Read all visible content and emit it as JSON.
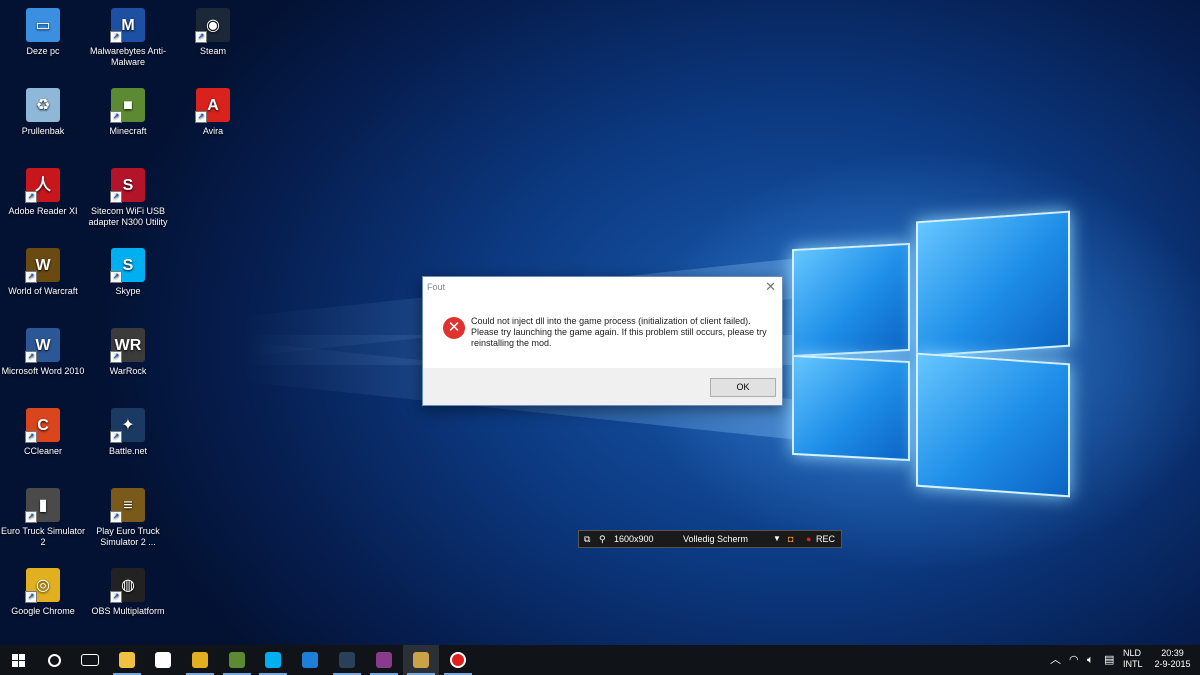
{
  "desktop": {
    "icons": [
      {
        "label": "Deze pc",
        "icon": "computer-icon",
        "color": "#3a8fe0",
        "glyph": "▭"
      },
      {
        "label": "Malwarebytes Anti-Malware",
        "icon": "malwarebytes-icon",
        "color": "#1d4fa3",
        "glyph": "M"
      },
      {
        "label": "Steam",
        "icon": "steam-icon",
        "color": "#1b2838",
        "glyph": "◉"
      },
      {
        "label": "Prullenbak",
        "icon": "recycle-bin-icon",
        "color": "#8fb8d8",
        "glyph": "♻"
      },
      {
        "label": "Minecraft",
        "icon": "minecraft-icon",
        "color": "#5b8a32",
        "glyph": "■"
      },
      {
        "label": "Avira",
        "icon": "avira-icon",
        "color": "#d9221c",
        "glyph": "A"
      },
      {
        "label": "Adobe Reader XI",
        "icon": "adobe-reader-icon",
        "color": "#c8161d",
        "glyph": "人"
      },
      {
        "label": "Sitecom WiFi USB adapter N300 Utility",
        "icon": "sitecom-icon",
        "color": "#b3142a",
        "glyph": "S"
      },
      {
        "label": "World of Warcraft",
        "icon": "wow-icon",
        "color": "#6b4a12",
        "glyph": "W"
      },
      {
        "label": "Skype",
        "icon": "skype-icon",
        "color": "#00aff0",
        "glyph": "S"
      },
      {
        "label": "Microsoft Word 2010",
        "icon": "word-icon",
        "color": "#2b5797",
        "glyph": "W"
      },
      {
        "label": "WarRock",
        "icon": "warrock-icon",
        "color": "#3b3b3b",
        "glyph": "WR"
      },
      {
        "label": "CCleaner",
        "icon": "ccleaner-icon",
        "color": "#d9451c",
        "glyph": "C"
      },
      {
        "label": "Battle.net",
        "icon": "battlenet-icon",
        "color": "#1b3a63",
        "glyph": "✦"
      },
      {
        "label": "Euro Truck Simulator 2",
        "icon": "ets2-icon",
        "color": "#4a4a4a",
        "glyph": "▮"
      },
      {
        "label": "Play Euro Truck Simulator 2 ...",
        "icon": "ets2-play-icon",
        "color": "#7a5a1a",
        "glyph": "≡"
      },
      {
        "label": "Google Chrome",
        "icon": "chrome-icon",
        "color": "#e0b020",
        "glyph": "◎"
      },
      {
        "label": "OBS Multiplatform",
        "icon": "obs-icon",
        "color": "#222222",
        "glyph": "◍"
      }
    ]
  },
  "dialog": {
    "title": "Fout",
    "close_glyph": "✕",
    "message": "Could not inject dll into the game process (initialization of client failed). Please try launching the game again. If this problem still occurs, please try reinstalling the mod.",
    "ok_label": "OK",
    "error_glyph": "✕"
  },
  "recorder": {
    "resolution": "1600x900",
    "mode": "Volledig Scherm",
    "rec_label": "REC"
  },
  "taskbar": {
    "items": [
      {
        "name": "start-button",
        "icon": "windows-start-icon",
        "color": "#ffffff"
      },
      {
        "name": "search-button",
        "icon": "search-icon",
        "color": "#ffffff"
      },
      {
        "name": "task-view-button",
        "icon": "task-view-icon",
        "color": "#ffffff"
      },
      {
        "name": "file-explorer",
        "icon": "folder-icon",
        "color": "#f0c040"
      },
      {
        "name": "store",
        "icon": "store-icon",
        "color": "#ffffff"
      },
      {
        "name": "chrome",
        "icon": "chrome-icon",
        "color": "#e0b020"
      },
      {
        "name": "minecraft",
        "icon": "minecraft-icon",
        "color": "#5b8a32"
      },
      {
        "name": "skype",
        "icon": "skype-icon",
        "color": "#00aff0"
      },
      {
        "name": "edge",
        "icon": "edge-icon",
        "color": "#1e7fd6"
      },
      {
        "name": "steam",
        "icon": "steam-icon",
        "color": "#2a3f5a"
      },
      {
        "name": "winrar",
        "icon": "winrar-icon",
        "color": "#8a3a8a"
      },
      {
        "name": "ets2",
        "icon": "ets2-icon",
        "color": "#c9a24a"
      },
      {
        "name": "obs-record",
        "icon": "record-icon",
        "color": "#e0201c"
      }
    ],
    "tray": {
      "language": "NLD",
      "layout": "INTL",
      "time": "20:39",
      "date": "2-9-2015"
    }
  }
}
